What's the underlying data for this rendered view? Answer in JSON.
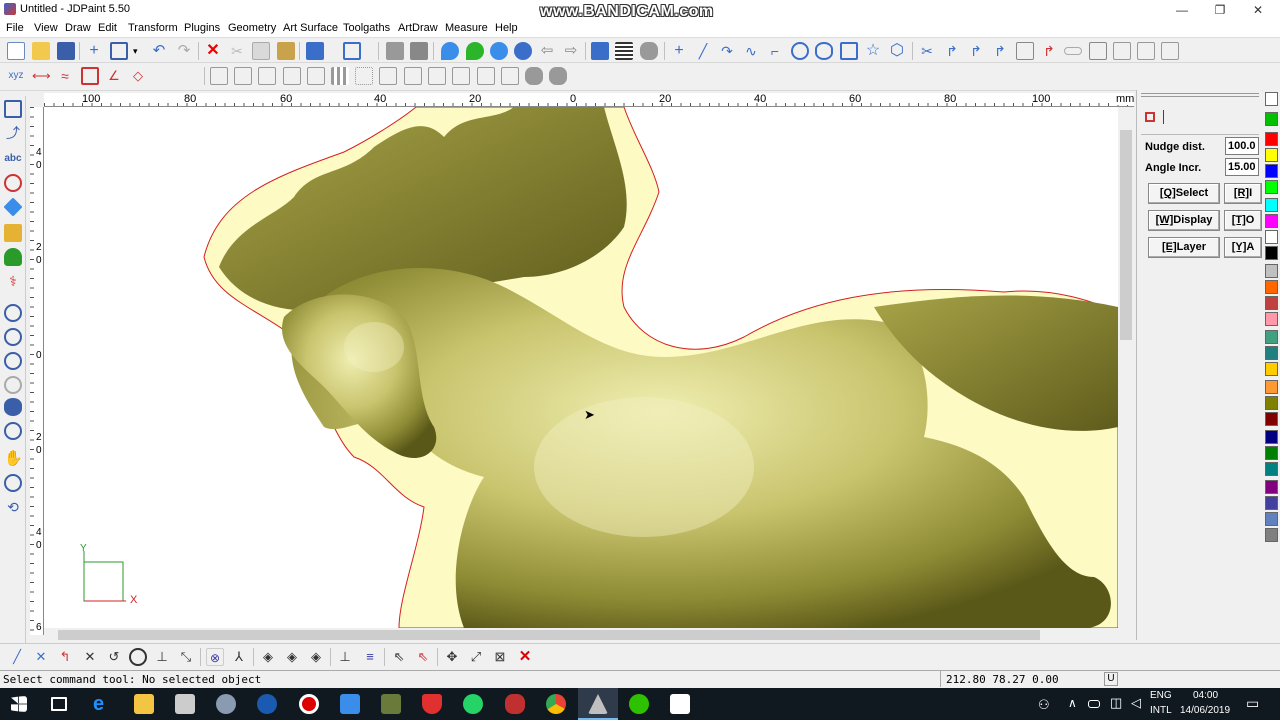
{
  "window": {
    "title": "Untitled - JDPaint 5.50",
    "watermark": "www.BANDICAM.com",
    "minimize": "—",
    "maximize": "❐",
    "close": "✕"
  },
  "menu": [
    "File",
    "View",
    "Draw",
    "Edit",
    "Transform",
    "Plugins",
    "Geometry",
    "Art Surface",
    "Toolgaths",
    "ArtDraw",
    "Measure",
    "Help"
  ],
  "ruler": {
    "top_labels": [
      "100",
      "80",
      "60",
      "40",
      "20",
      "0",
      "20",
      "40",
      "60",
      "80",
      "100"
    ],
    "unit": "mm",
    "left_labels": [
      "4",
      "0",
      "2",
      "0",
      "0",
      "2",
      "0",
      "4",
      "0",
      "6"
    ]
  },
  "axis": {
    "x_label": "X",
    "y_label": "Y"
  },
  "panel": {
    "icon": "select-tool-icon",
    "nudge_label": "Nudge dist.",
    "nudge_value": "100.0",
    "angle_label": "Angle Incr.",
    "angle_value": "15.00",
    "buttons": [
      {
        "key": "[Q]",
        "label": "Select"
      },
      {
        "key": "[R]",
        "label": "I"
      },
      {
        "key": "[W]",
        "label": "Display"
      },
      {
        "key": "[T]",
        "label": "O"
      },
      {
        "key": "[E]",
        "label": "Layer"
      },
      {
        "key": "[Y]",
        "label": "A"
      }
    ]
  },
  "palette": [
    "#ffffff",
    "#00c000",
    "#ff0000",
    "#ffff00",
    "#0000ff",
    "#00ff00",
    "#00ffff",
    "#ff00ff",
    "#ffffff",
    "#000000",
    "#c0c0c0",
    "#ff6600",
    "#c04040",
    "#ff99aa",
    "#40a080",
    "#208080",
    "#ffcc00",
    "#ff9933",
    "#808000",
    "#800000",
    "#000080",
    "#008000",
    "#008080",
    "#800080",
    "#4040a0",
    "#6080c0",
    "#808080"
  ],
  "status": {
    "message": "Select command tool: No selected object",
    "coords": "212.80 78.27 0.00",
    "unit_indicator": "U"
  },
  "taskbar": {
    "lang_top": "ENG",
    "lang_bottom": "INTL",
    "time": "04:00",
    "date": "14/06/2019"
  }
}
